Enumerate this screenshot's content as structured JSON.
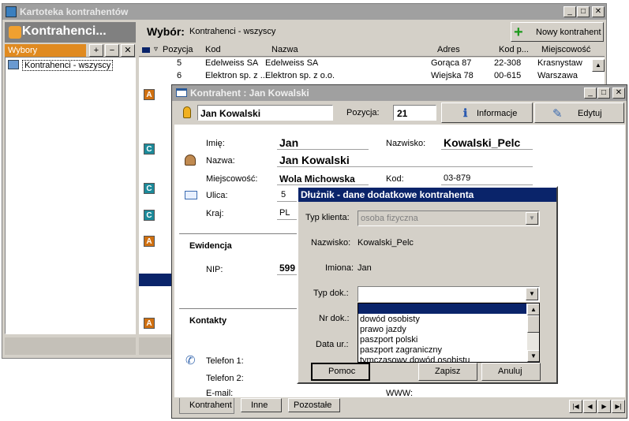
{
  "main_window": {
    "title": "Kartoteka kontrahentów",
    "sidebar": {
      "header": "Kontrahenci...",
      "section": "Wybory",
      "plus": "+",
      "minus": "−",
      "close": "✕",
      "tree_item": "Kontrahenci - wszyscy"
    },
    "selection": {
      "label": "Wybór:",
      "value": "Kontrahenci - wszyscy"
    },
    "new_button": "Nowy kontrahent",
    "columns": [
      "Pozycja",
      "Kod",
      "Nazwa",
      "Adres",
      "Kod p...",
      "Miejscowość"
    ],
    "rows": [
      {
        "pos": "5",
        "kod": "Edelweiss SA",
        "nazwa": "Edelweiss SA",
        "adres": "Gorąca 87",
        "kodp": "22-308",
        "miejsc": "Krasnystaw"
      },
      {
        "pos": "6",
        "kod": "Elektron sp. z ...",
        "nazwa": "Elektron sp. z o.o.",
        "adres": "Wiejska 78",
        "kodp": "00-615",
        "miejsc": "Warszawa"
      }
    ],
    "badges": [
      "A",
      "C",
      "C",
      "C",
      "A",
      "A"
    ]
  },
  "contractor_window": {
    "title": "Kontrahent : Jan Kowalski",
    "name_field": "Jan Kowalski",
    "position_label": "Pozycja:",
    "position_value": "21",
    "info_button": "Informacje",
    "edit_button": "Edytuj",
    "labels": {
      "first_name": "Imię:",
      "last_name": "Nazwisko:",
      "name": "Nazwa:",
      "city": "Miejscowość:",
      "code": "Kod:",
      "street": "Ulica:",
      "country": "Kraj:",
      "section_ewidencja": "Ewidencja",
      "nip": "NIP:",
      "section_kontakty": "Kontakty",
      "phone1": "Telefon 1:",
      "phone2": "Telefon 2:",
      "email": "E-mail:",
      "www": "WWW:"
    },
    "values": {
      "first_name": "Jan",
      "last_name": "Kowalski_Pelc",
      "name": "Jan Kowalski",
      "city": "Wola Michowska",
      "code": "03-879",
      "street": "5",
      "country": "PL",
      "nip": "599"
    },
    "tabs": [
      "Kontrahent",
      "Inne",
      "Pozostałe"
    ],
    "nav": [
      "|◀",
      "◀",
      "▶",
      "▶|"
    ]
  },
  "debtor_dialog": {
    "title": "Dłużnik - dane dodatkowe kontrahenta",
    "client_type_label": "Typ klienta:",
    "client_type_value": "osoba fizyczna",
    "last_name_label": "Nazwisko:",
    "last_name_value": "Kowalski_Pelc",
    "first_names_label": "Imiona:",
    "first_names_value": "Jan",
    "doc_type_label": "Typ dok.:",
    "doc_nr_label": "Nr dok.:",
    "issue_date_label": "Data ur.:",
    "dropdown_options": [
      "dowód osobisty",
      "prawo jazdy",
      "paszport polski",
      "paszport zagraniczny",
      "tymczasowy dowód osobistu"
    ],
    "help_button": "Pomoc",
    "save_button": "Zapisz",
    "cancel_button": "Anuluj"
  }
}
